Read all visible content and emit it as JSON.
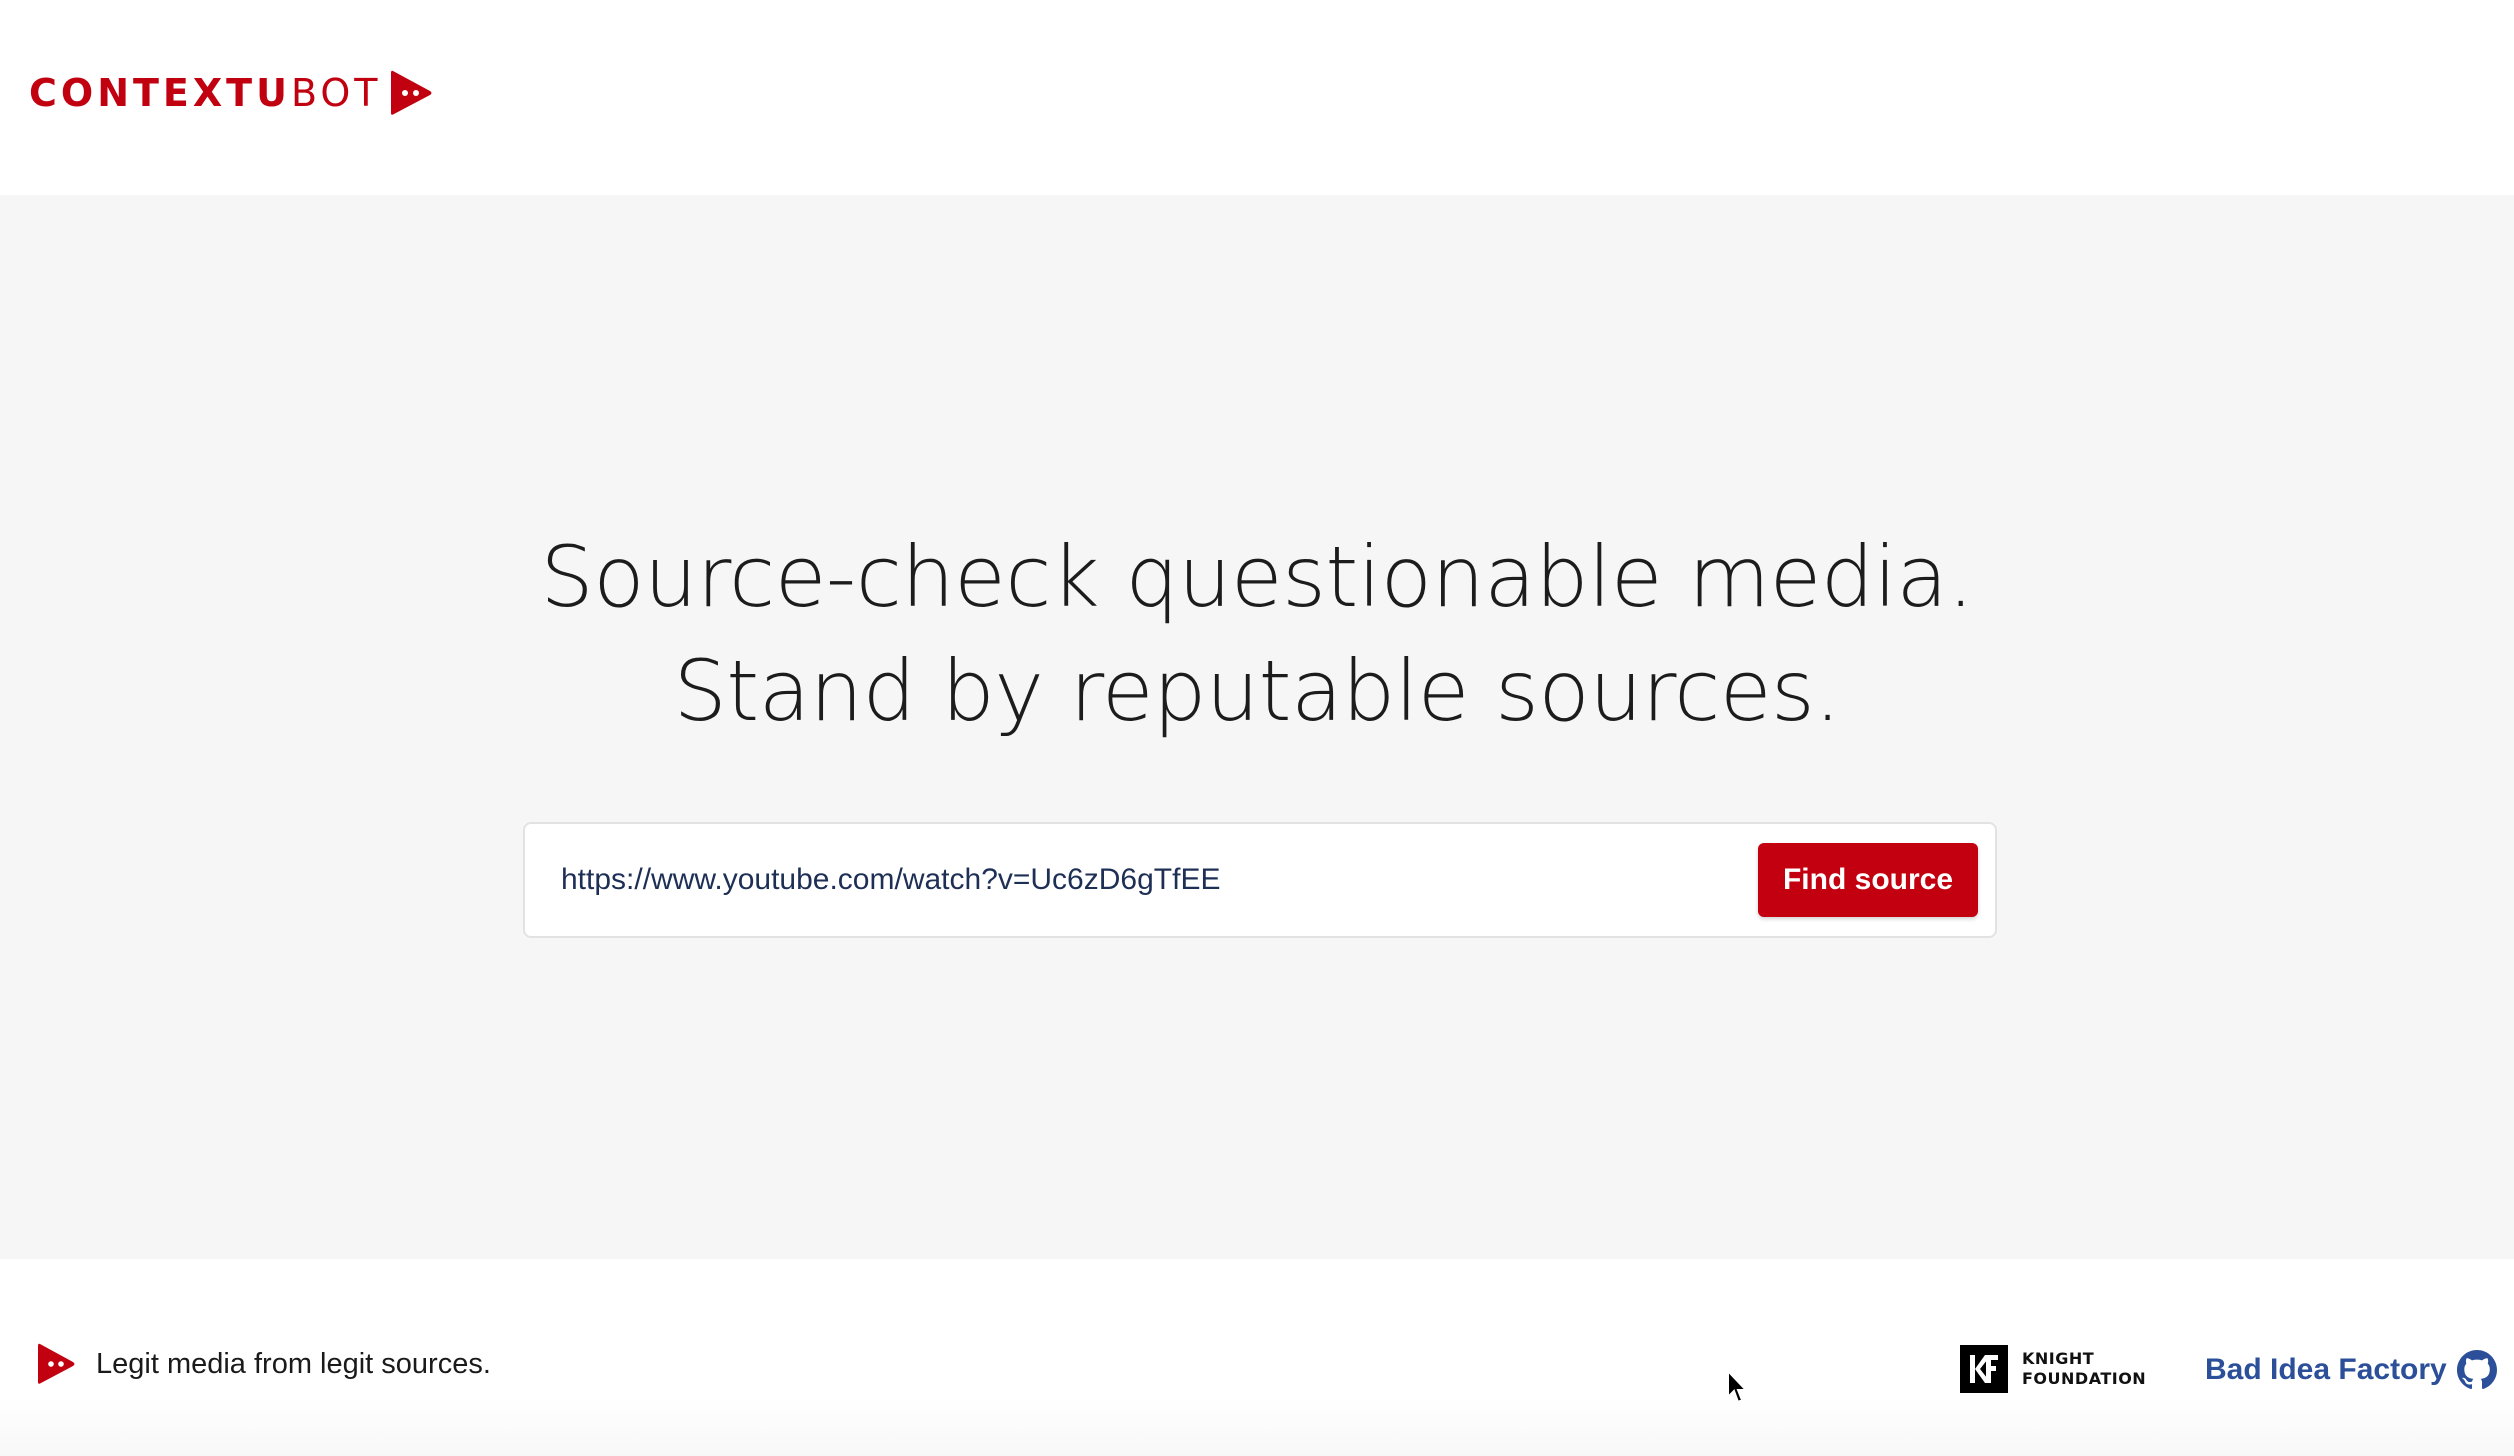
{
  "header": {
    "logo_bold": "CONTEXTU",
    "logo_light": "BOT",
    "logo_icon": "play-robot-icon"
  },
  "hero": {
    "headline_line1": "Source-check questionable media.",
    "headline_line2": "Stand by reputable sources.",
    "search": {
      "value": "https://www.youtube.com/watch?v=Uc6zD6gTfEE",
      "button_label": "Find source"
    }
  },
  "footer": {
    "tagline": "Legit media from legit sources.",
    "knight_line1": "KNIGHT",
    "knight_line2": "FOUNDATION",
    "bad_idea_factory": "Bad Idea Factory",
    "github_icon": "github-icon"
  },
  "colors": {
    "brand_red": "#c3000f",
    "hero_background": "#f6f6f6",
    "link_blue": "#2c4f9a"
  }
}
